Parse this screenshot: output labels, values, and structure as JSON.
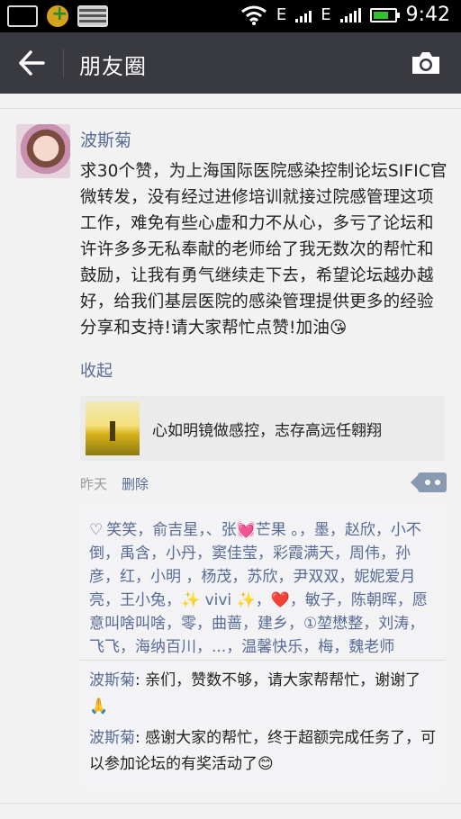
{
  "status_bar": {
    "network_e1": "E",
    "network_e2": "E",
    "time": "9:42"
  },
  "title_bar": {
    "title": "朋友圈",
    "icons": [
      "back-arrow-icon",
      "camera-icon"
    ]
  },
  "post": {
    "author": "波斯菊",
    "text": "求30个赞，为上海国际医院感染控制论坛SIFIC官微转发，没有经过进修培训就接过院感管理这项工作，难免有些心虚和力不从心，多亏了论坛和许许多多无私奉献的老师给了我无数次的帮忙和鼓励，让我有勇气继续走下去，希望论坛越办越好，给我们基层医院的感染管理提供更多的经验分享和支持!请大家帮忙点赞!加油😘",
    "collapse_label": "收起",
    "shared_link": {
      "title": "心如明镜做感控，志存高远任翱翔"
    },
    "time": "昨天",
    "delete_label": "删除"
  },
  "likes": "笑笑，俞吉星，、张💓芒果 。，墨，赵欣，小不倒，禹含，小丹，窦佳莹，彩霞满天，周伟，孙彦，红，小明 ，杨茂，苏欣，尹双双，妮妮爱月亮，王小兔，✨ vivi ✨，❤️，敏子，陈朝晖，愿意叫啥叫啥，零，曲蔷，建乡，①堃懋整，刘涛，飞飞，海纳百川，...，温馨快乐，梅，魏老师",
  "comments": [
    {
      "name": "波斯菊",
      "sep": ": ",
      "text": "亲们，赞数不够，请大家帮帮忙，谢谢了🙏"
    },
    {
      "name": "波斯菊",
      "sep": ": ",
      "text": "感谢大家的帮忙，终于超额完成任务了，可以参加论坛的有奖活动了😊"
    }
  ],
  "colors": {
    "title_bar": "#393a3f",
    "link_blue": "#576b95",
    "background": "#f2f2f2"
  }
}
